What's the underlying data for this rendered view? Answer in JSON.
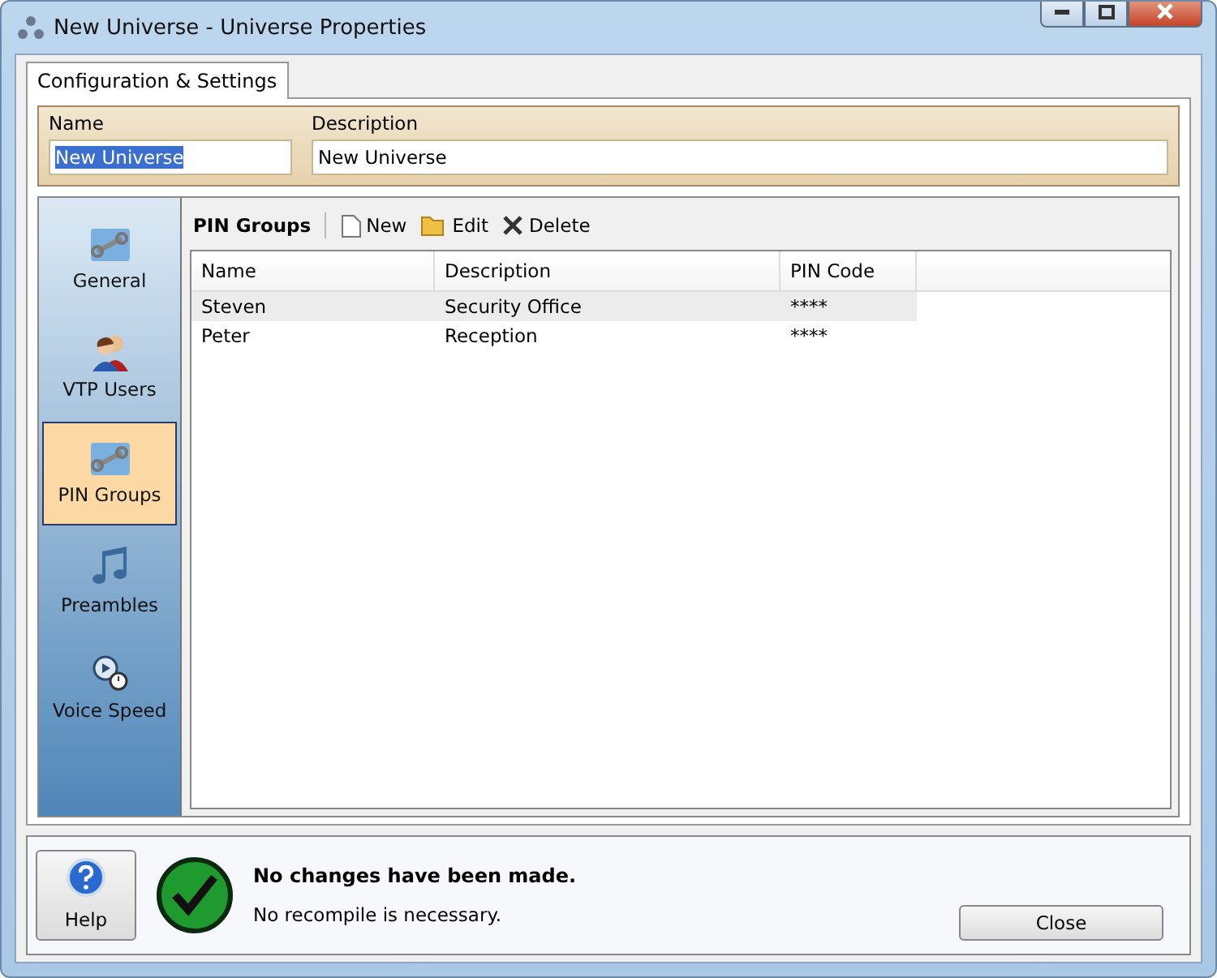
{
  "window": {
    "title": "New Universe - Universe Properties"
  },
  "tabs": [
    {
      "label": "Configuration & Settings",
      "selected": true
    }
  ],
  "header": {
    "name_label": "Name",
    "name_value": "New Universe",
    "description_label": "Description",
    "description_value": "New Universe"
  },
  "sidebar": {
    "items": [
      {
        "label": "General",
        "kind": "wrench",
        "selected": false
      },
      {
        "label": "VTP Users",
        "kind": "users",
        "selected": false
      },
      {
        "label": "PIN Groups",
        "kind": "wrench",
        "selected": true
      },
      {
        "label": "Preambles",
        "kind": "music",
        "selected": false
      },
      {
        "label": "Voice Speed",
        "kind": "speed",
        "selected": false
      }
    ]
  },
  "toolbar": {
    "title": "PIN Groups",
    "buttons": [
      {
        "label": "New",
        "kind": "new"
      },
      {
        "label": "Edit",
        "kind": "edit"
      },
      {
        "label": "Delete",
        "kind": "delete"
      }
    ]
  },
  "table": {
    "columns": [
      "Name",
      "Description",
      "PIN Code"
    ],
    "rows": [
      {
        "cells": [
          "Steven",
          "Security Office",
          "****"
        ],
        "selected": true
      },
      {
        "cells": [
          "Peter",
          "Reception",
          "****"
        ],
        "selected": false
      }
    ]
  },
  "footer": {
    "help_label": "Help",
    "status_title": "No changes have been made.",
    "status_detail": "No recompile is necessary.",
    "close_label": "Close"
  }
}
